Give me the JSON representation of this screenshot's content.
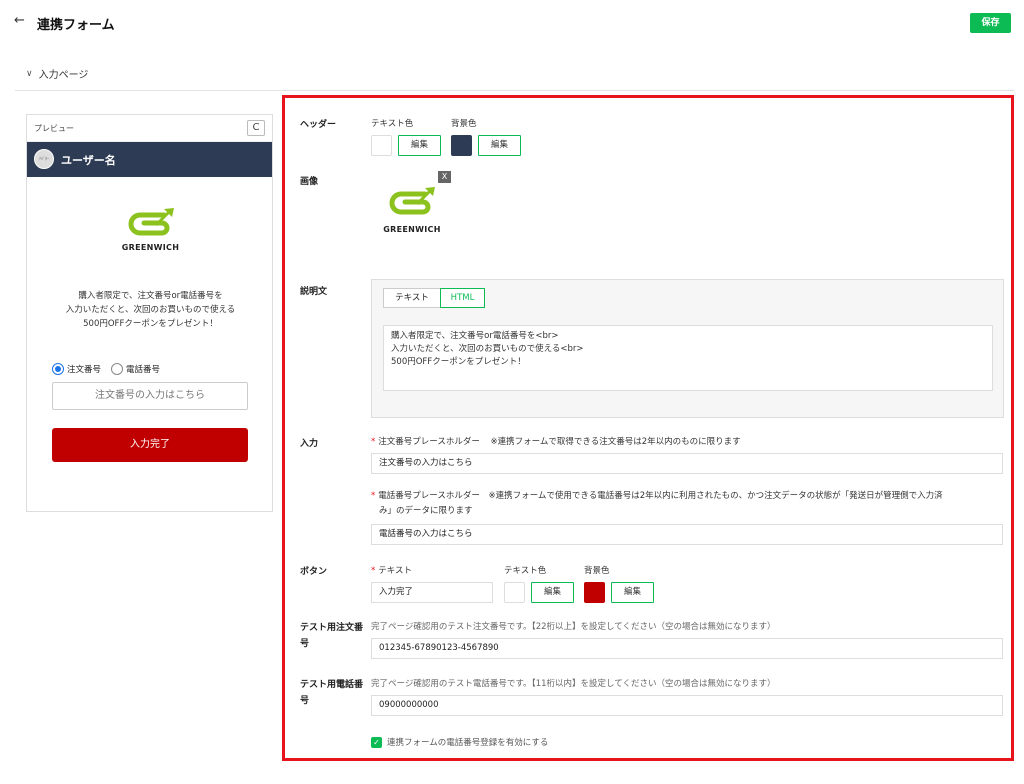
{
  "header": {
    "back_icon": "←",
    "title": "連携フォーム",
    "save_label": "保存"
  },
  "section": {
    "toggle_label": "入力ページ",
    "chevron": "∨"
  },
  "preview": {
    "label": "プレビュー",
    "refresh_icon": "C",
    "avatar_text": "ｱﾊﾞﾀｰ",
    "username": "ユーザー名",
    "logo_text": "GREENWICH",
    "description_lines": [
      "購入者限定で、注文番号or電話番号を",
      "入力いただくと、次回のお買いもので使える",
      "500円OFFクーポンをプレゼント！"
    ],
    "radio_order": "注文番号",
    "radio_phone": "電話番号",
    "input_placeholder": "注文番号の入力はこちら",
    "submit_label": "入力完了",
    "colors": {
      "bar": "#2e3b54",
      "submit": "#c00000",
      "logo": "#8cc21e"
    }
  },
  "settings": {
    "header": {
      "label": "ヘッダー",
      "text_color_label": "テキスト色",
      "bg_color_label": "背景色",
      "edit_label": "編集",
      "text_color": "#ffffff",
      "bg_color": "#2e3b54"
    },
    "image": {
      "label": "画像",
      "close_icon": "X",
      "logo_text": "GREENWICH"
    },
    "description": {
      "label": "説明文",
      "tab_text": "テキスト",
      "tab_html": "HTML",
      "content": "購入者限定で、注文番号or電話番号を<br>\n入力いただくと、次回のお買いもので使える<br>\n500円OFFクーポンをプレゼント！"
    },
    "input": {
      "label": "入力",
      "order_placeholder_label": "注文番号プレースホルダー",
      "order_note": "※連携フォームで取得できる注文番号は2年以内のものに限ります",
      "order_placeholder_value": "注文番号の入力はこちら",
      "phone_placeholder_label": "電話番号プレースホルダー",
      "phone_note_1": "※連携フォームで使用できる電話番号は2年以内に利用されたもの、かつ注文データの状態が「発送日が管理側で入力済",
      "phone_note_2": "み」のデータに限ります",
      "phone_placeholder_value": "電話番号の入力はこちら"
    },
    "button": {
      "label": "ボタン",
      "text_label": "テキスト",
      "text_value": "入力完了",
      "text_color_label": "テキスト色",
      "bg_color_label": "背景色",
      "edit_label": "編集",
      "text_color": "#ffffff",
      "bg_color": "#c00000"
    },
    "test_order": {
      "label_1": "テスト用注文番",
      "label_2": "号",
      "hint": "完了ページ確認用のテスト注文番号です。【22桁以上】を設定してください（空の場合は無効になります）",
      "value": "012345-67890123-4567890"
    },
    "test_phone": {
      "label_1": "テスト用電話番",
      "label_2": "号",
      "hint": "完了ページ確認用のテスト電話番号です。【11桁以内】を設定してください（空の場合は無効になります）",
      "value": "09000000000"
    },
    "enable_phone": {
      "checked_icon": "✓",
      "label": "連携フォームの電話番号登録を有効にする"
    }
  }
}
